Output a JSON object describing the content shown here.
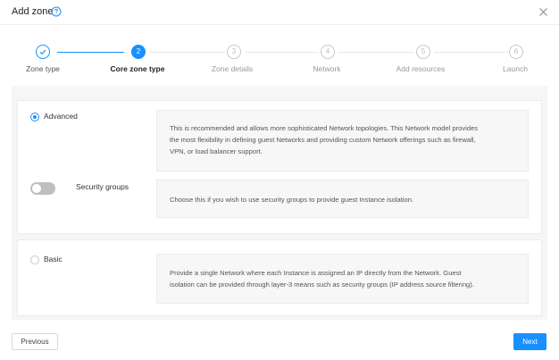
{
  "dialog": {
    "title": "Add zone",
    "help_icon": "question-circle-icon",
    "close_icon": "close-icon"
  },
  "steps": [
    {
      "label": "Zone type",
      "number": "1",
      "status": "done"
    },
    {
      "label": "Core zone type",
      "number": "2",
      "status": "active"
    },
    {
      "label": "Zone details",
      "number": "3",
      "status": "wait"
    },
    {
      "label": "Network",
      "number": "4",
      "status": "wait"
    },
    {
      "label": "Add resources",
      "number": "5",
      "status": "wait"
    },
    {
      "label": "Launch",
      "number": "6",
      "status": "wait"
    }
  ],
  "advanced": {
    "label": "Advanced",
    "selected": true,
    "description": [
      "This is recommended and allows more sophisticated Network topologies. This Network model provides",
      "the most flexibility in defining guest Networks and providing custom Network offerings such as firewall,",
      "VPN, or load balancer support."
    ],
    "security_groups": {
      "label": "Security groups",
      "enabled": false,
      "description": "Choose this if you wish to use security groups to provide guest Instance isolation."
    }
  },
  "basic": {
    "label": "Basic",
    "selected": false,
    "description": [
      "Provide a single Network where each Instance is assigned an IP directly from the Network. Guest",
      "isolation can be provided through layer-3 means such as security groups (IP address source filtering)."
    ]
  },
  "footer": {
    "previous_label": "Previous",
    "next_label": "Next"
  },
  "colors": {
    "accent": "#1890ff",
    "toggle_off": "#bfbfbf"
  }
}
